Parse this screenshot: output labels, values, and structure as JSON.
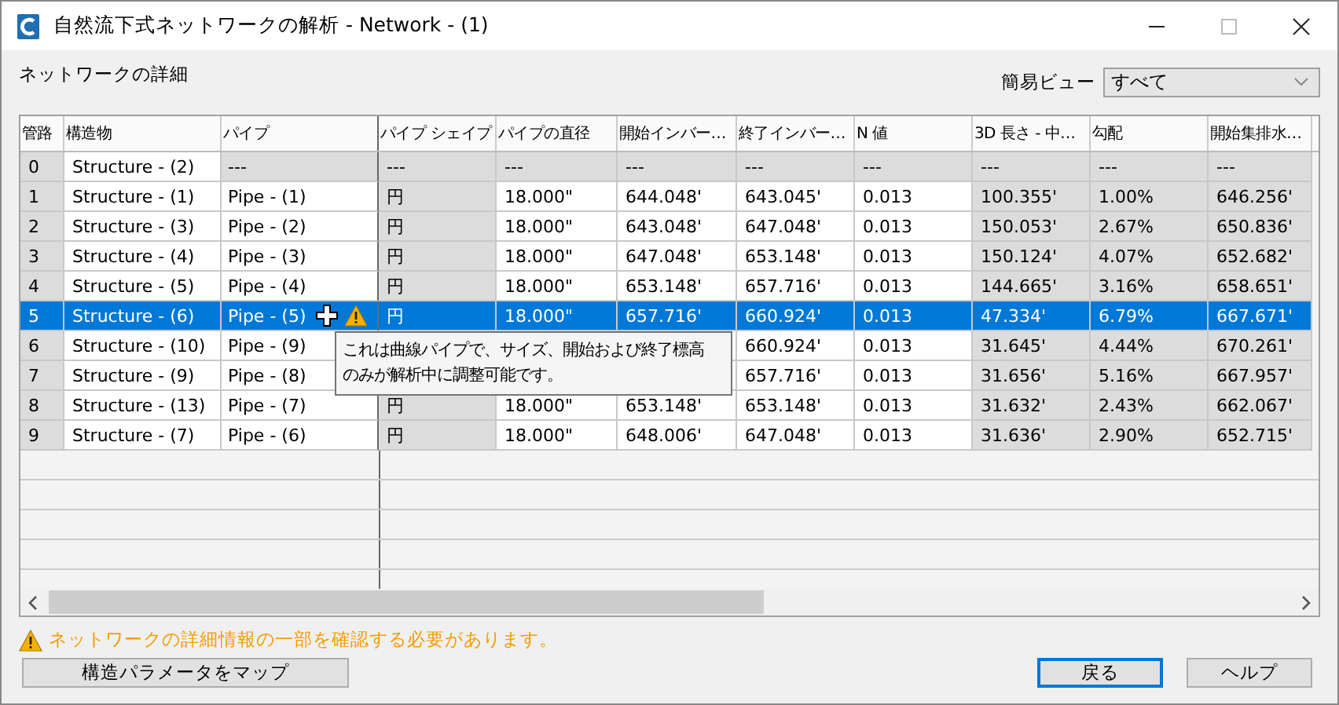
{
  "window": {
    "title": "自然流下式ネットワークの解析 - Network - (1)"
  },
  "section_label": "ネットワークの詳細",
  "view": {
    "label": "簡易ビュー",
    "value": "すべて"
  },
  "table": {
    "columns": [
      {
        "label": "管路",
        "editable": false
      },
      {
        "label": "構造物",
        "editable": true
      },
      {
        "label": "パイプ",
        "editable": true
      },
      {
        "label": "パイプ シェイプ",
        "editable": false
      },
      {
        "label": "パイプの直径",
        "editable": true
      },
      {
        "label": "開始インバー…",
        "editable": true
      },
      {
        "label": "終了インバー…",
        "editable": true
      },
      {
        "label": "N 値",
        "editable": true
      },
      {
        "label": "3D 長さ - 中…",
        "editable": false
      },
      {
        "label": "勾配",
        "editable": false
      },
      {
        "label": "開始集排水…",
        "editable": false
      }
    ],
    "rows": [
      {
        "outlet": true,
        "selected": false,
        "warning": false,
        "cells": [
          "0",
          "Structure - (2)",
          "---",
          "---",
          "---",
          "---",
          "---",
          "---",
          "---",
          "---",
          "---"
        ]
      },
      {
        "outlet": false,
        "selected": false,
        "warning": false,
        "cells": [
          "1",
          "Structure - (1)",
          "Pipe - (1)",
          "円",
          "18.000\"",
          "644.048'",
          "643.045'",
          "0.013",
          "100.355'",
          "1.00%",
          "646.256'"
        ]
      },
      {
        "outlet": false,
        "selected": false,
        "warning": false,
        "cells": [
          "2",
          "Structure - (3)",
          "Pipe - (2)",
          "円",
          "18.000\"",
          "643.048'",
          "647.048'",
          "0.013",
          "150.053'",
          "2.67%",
          "650.836'"
        ]
      },
      {
        "outlet": false,
        "selected": false,
        "warning": false,
        "cells": [
          "3",
          "Structure - (4)",
          "Pipe - (3)",
          "円",
          "18.000\"",
          "647.048'",
          "653.148'",
          "0.013",
          "150.124'",
          "4.07%",
          "652.682'"
        ]
      },
      {
        "outlet": false,
        "selected": false,
        "warning": false,
        "cells": [
          "4",
          "Structure - (5)",
          "Pipe - (4)",
          "円",
          "18.000\"",
          "653.148'",
          "657.716'",
          "0.013",
          "144.665'",
          "3.16%",
          "658.651'"
        ]
      },
      {
        "outlet": false,
        "selected": true,
        "warning": true,
        "cells": [
          "5",
          "Structure - (6)",
          "Pipe - (5)",
          "円",
          "18.000\"",
          "657.716'",
          "660.924'",
          "0.013",
          "47.334'",
          "6.79%",
          "667.671'"
        ]
      },
      {
        "outlet": false,
        "selected": false,
        "warning": false,
        "cells": [
          "6",
          "Structure - (10)",
          "Pipe - (9)",
          null,
          null,
          null,
          "660.924'",
          "0.013",
          "31.645'",
          "4.44%",
          "670.261'"
        ]
      },
      {
        "outlet": false,
        "selected": false,
        "warning": false,
        "cells": [
          "7",
          "Structure - (9)",
          "Pipe - (8)",
          null,
          null,
          null,
          "657.716'",
          "0.013",
          "31.656'",
          "5.16%",
          "667.957'"
        ]
      },
      {
        "outlet": false,
        "selected": false,
        "warning": false,
        "cells": [
          "8",
          "Structure - (13)",
          "Pipe - (7)",
          "円",
          "18.000\"",
          "653.148'",
          "653.148'",
          "0.013",
          "31.632'",
          "2.43%",
          "662.067'"
        ]
      },
      {
        "outlet": false,
        "selected": false,
        "warning": false,
        "cells": [
          "9",
          "Structure - (7)",
          "Pipe - (6)",
          "円",
          "18.000\"",
          "648.006'",
          "647.048'",
          "0.013",
          "31.636'",
          "2.90%",
          "652.715'"
        ]
      }
    ]
  },
  "tooltip": {
    "lines": [
      "これは曲線パイプで、サイズ、開始および終了標高",
      "のみが解析中に調整可能です。"
    ]
  },
  "warning_message": "ネットワークの詳細情報の一部を確認する必要があります。",
  "buttons": [
    {
      "label": "構造パラメータをマップ",
      "default": false
    },
    {
      "label": "戻る",
      "default": true
    },
    {
      "label": "ヘルプ",
      "default": false
    }
  ]
}
